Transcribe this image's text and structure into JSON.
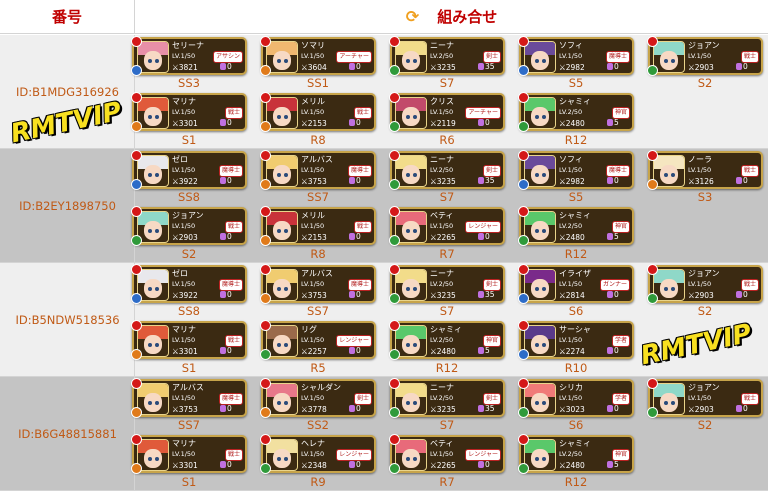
{
  "header": {
    "col_id": "番号",
    "col_combo": "組み合せ",
    "refresh_icon": "refresh-icon"
  },
  "watermark": "RMTVIP",
  "groups": [
    {
      "id": "ID:B1MDG316926",
      "shade": "light",
      "rows": [
        [
          {
            "name": "セリーナ",
            "level": "LV.1/50",
            "power": "3821",
            "job": "アサシン",
            "gems": "0",
            "rank": "SS3",
            "hair": "#e88fa8",
            "frame": "blue"
          },
          {
            "name": "ソマリ",
            "level": "LV.1/50",
            "power": "3604",
            "job": "アーチャー",
            "gems": "0",
            "rank": "SS1",
            "hair": "#f0b870",
            "frame": "orange"
          },
          {
            "name": "ニーナ",
            "level": "LV.2/50",
            "power": "3235",
            "job": "剣士",
            "gems": "35",
            "rank": "S7",
            "hair": "#f2dc8a",
            "frame": "green"
          },
          {
            "name": "ソフィ",
            "level": "LV.1/50",
            "power": "2982",
            "job": "魔導士",
            "gems": "0",
            "rank": "S5",
            "hair": "#6a4a9a",
            "frame": "blue"
          },
          {
            "name": "ジョアン",
            "level": "LV.1/50",
            "power": "2903",
            "job": "戦士",
            "gems": "0",
            "rank": "S2",
            "hair": "#8fd8c8",
            "frame": "green"
          }
        ],
        [
          {
            "name": "マリナ",
            "level": "LV.1/50",
            "power": "3301",
            "job": "戦士",
            "gems": "0",
            "rank": "S1",
            "hair": "#e05a3a",
            "frame": "orange"
          },
          {
            "name": "メリル",
            "level": "LV.1/50",
            "power": "2153",
            "job": "戦士",
            "gems": "0",
            "rank": "R8",
            "hair": "#c8323a",
            "frame": "orange"
          },
          {
            "name": "クリス",
            "level": "LV.1/50",
            "power": "2119",
            "job": "アーチャー",
            "gems": "0",
            "rank": "R6",
            "hair": "#c24a6a",
            "frame": "green"
          },
          {
            "name": "シャミィ",
            "level": "LV.2/50",
            "power": "2480",
            "job": "神官",
            "gems": "5",
            "rank": "R12",
            "hair": "#5ac86a",
            "frame": "green"
          }
        ]
      ]
    },
    {
      "id": "ID:B2EY1898750",
      "shade": "dark",
      "rows": [
        [
          {
            "name": "ゼロ",
            "level": "LV.1/50",
            "power": "3922",
            "job": "魔導士",
            "gems": "0",
            "rank": "SS8",
            "hair": "#e8e8ec",
            "frame": "blue"
          },
          {
            "name": "アルバス",
            "level": "LV.1/50",
            "power": "3753",
            "job": "魔導士",
            "gems": "0",
            "rank": "SS7",
            "hair": "#f0cc70",
            "frame": "orange"
          },
          {
            "name": "ニーナ",
            "level": "LV.2/50",
            "power": "3235",
            "job": "剣士",
            "gems": "35",
            "rank": "S7",
            "hair": "#f2dc8a",
            "frame": "green"
          },
          {
            "name": "ソフィ",
            "level": "LV.1/50",
            "power": "2982",
            "job": "魔導士",
            "gems": "0",
            "rank": "S5",
            "hair": "#6a4a9a",
            "frame": "blue"
          },
          {
            "name": "ノーラ",
            "level": "LV.1/50",
            "power": "3126",
            "job": "戦士",
            "gems": "0",
            "rank": "S3",
            "hair": "#f5e6c0",
            "frame": "orange"
          }
        ],
        [
          {
            "name": "ジョアン",
            "level": "LV.1/50",
            "power": "2903",
            "job": "戦士",
            "gems": "0",
            "rank": "S2",
            "hair": "#8fd8c8",
            "frame": "green"
          },
          {
            "name": "メリル",
            "level": "LV.1/50",
            "power": "2153",
            "job": "戦士",
            "gems": "0",
            "rank": "R8",
            "hair": "#c8323a",
            "frame": "orange"
          },
          {
            "name": "ベティ",
            "level": "LV.1/50",
            "power": "2265",
            "job": "レンジャー",
            "gems": "0",
            "rank": "R7",
            "hair": "#e86a7a",
            "frame": "green"
          },
          {
            "name": "シャミィ",
            "level": "LV.2/50",
            "power": "2480",
            "job": "神官",
            "gems": "5",
            "rank": "R12",
            "hair": "#5ac86a",
            "frame": "green"
          }
        ]
      ]
    },
    {
      "id": "ID:B5NDW518536",
      "shade": "light",
      "rows": [
        [
          {
            "name": "ゼロ",
            "level": "LV.1/50",
            "power": "3922",
            "job": "魔導士",
            "gems": "0",
            "rank": "SS8",
            "hair": "#e8e8ec",
            "frame": "blue"
          },
          {
            "name": "アルバス",
            "level": "LV.1/50",
            "power": "3753",
            "job": "魔導士",
            "gems": "0",
            "rank": "SS7",
            "hair": "#f0cc70",
            "frame": "orange"
          },
          {
            "name": "ニーナ",
            "level": "LV.2/50",
            "power": "3235",
            "job": "剣士",
            "gems": "35",
            "rank": "S7",
            "hair": "#f2dc8a",
            "frame": "green"
          },
          {
            "name": "イライザ",
            "level": "LV.1/50",
            "power": "2814",
            "job": "ガンナー",
            "gems": "0",
            "rank": "S6",
            "hair": "#7a2a8a",
            "frame": "blue"
          },
          {
            "name": "ジョアン",
            "level": "LV.1/50",
            "power": "2903",
            "job": "戦士",
            "gems": "0",
            "rank": "S2",
            "hair": "#8fd8c8",
            "frame": "green"
          }
        ],
        [
          {
            "name": "マリナ",
            "level": "LV.1/50",
            "power": "3301",
            "job": "戦士",
            "gems": "0",
            "rank": "S1",
            "hair": "#e05a3a",
            "frame": "orange"
          },
          {
            "name": "リグ",
            "level": "LV.1/50",
            "power": "2257",
            "job": "レンジャー",
            "gems": "0",
            "rank": "R5",
            "hair": "#9a6a4a",
            "frame": "green"
          },
          {
            "name": "シャミィ",
            "level": "LV.2/50",
            "power": "2480",
            "job": "神官",
            "gems": "5",
            "rank": "R12",
            "hair": "#5ac86a",
            "frame": "green"
          },
          {
            "name": "サーシャ",
            "level": "LV.1/50",
            "power": "2274",
            "job": "学者",
            "gems": "0",
            "rank": "R10",
            "hair": "#5a3a8a",
            "frame": "blue"
          }
        ]
      ]
    },
    {
      "id": "ID:B6G48815881",
      "shade": "dark",
      "rows": [
        [
          {
            "name": "アルバス",
            "level": "LV.1/50",
            "power": "3753",
            "job": "魔導士",
            "gems": "0",
            "rank": "SS7",
            "hair": "#f0cc70",
            "frame": "orange"
          },
          {
            "name": "シャルダン",
            "level": "LV.1/50",
            "power": "3778",
            "job": "剣士",
            "gems": "0",
            "rank": "SS2",
            "hair": "#e8788a",
            "frame": "orange"
          },
          {
            "name": "ニーナ",
            "level": "LV.2/50",
            "power": "3235",
            "job": "剣士",
            "gems": "35",
            "rank": "S7",
            "hair": "#f2dc8a",
            "frame": "green"
          },
          {
            "name": "シリカ",
            "level": "LV.1/50",
            "power": "3023",
            "job": "学者",
            "gems": "0",
            "rank": "S6",
            "hair": "#f07a78",
            "frame": "green"
          },
          {
            "name": "ジョアン",
            "level": "LV.1/50",
            "power": "2903",
            "job": "戦士",
            "gems": "0",
            "rank": "S2",
            "hair": "#8fd8c8",
            "frame": "green"
          }
        ],
        [
          {
            "name": "マリナ",
            "level": "LV.1/50",
            "power": "3301",
            "job": "戦士",
            "gems": "0",
            "rank": "S1",
            "hair": "#e05a3a",
            "frame": "orange"
          },
          {
            "name": "ヘレナ",
            "level": "LV.1/50",
            "power": "2348",
            "job": "レンジャー",
            "gems": "0",
            "rank": "R9",
            "hair": "#f2e0a0",
            "frame": "green"
          },
          {
            "name": "ベティ",
            "level": "LV.1/50",
            "power": "2265",
            "job": "レンジャー",
            "gems": "0",
            "rank": "R7",
            "hair": "#e86a7a",
            "frame": "green"
          },
          {
            "name": "シャミィ",
            "level": "LV.2/50",
            "power": "2480",
            "job": "神官",
            "gems": "5",
            "rank": "R12",
            "hair": "#5ac86a",
            "frame": "green"
          }
        ]
      ]
    }
  ]
}
